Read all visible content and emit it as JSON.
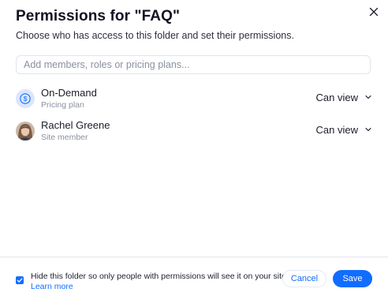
{
  "dialog": {
    "title": "Permissions for \"FAQ\"",
    "subtitle": "Choose who has access to this folder and set their permissions."
  },
  "search": {
    "placeholder": "Add members, roles or pricing plans..."
  },
  "members": [
    {
      "name": "On-Demand",
      "role": "Pricing plan",
      "permission": "Can view",
      "avatar_icon": "dollar-coin-icon"
    },
    {
      "name": "Rachel Greene",
      "role": "Site member",
      "permission": "Can view",
      "avatar_icon": "user-photo"
    }
  ],
  "footer": {
    "hide_checkbox_checked": true,
    "hide_text": "Hide this folder so only people with permissions will see it on your site.",
    "learn_more": "Learn more",
    "cancel_label": "Cancel",
    "save_label": "Save"
  },
  "colors": {
    "accent": "#116dff",
    "plan_avatar_bg": "#dbe6fb",
    "muted_text": "#8b90a0"
  }
}
